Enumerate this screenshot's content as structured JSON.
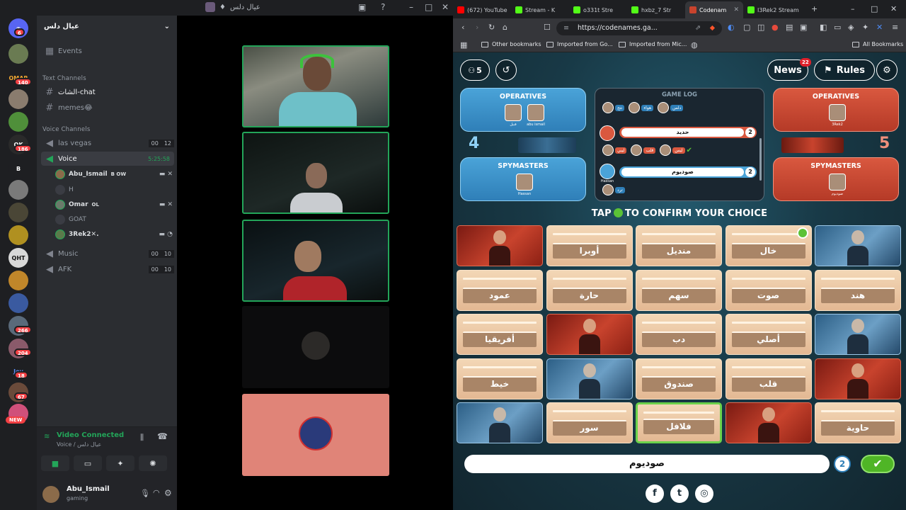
{
  "discord": {
    "window_title": "عيال دلس",
    "guild_name": "عيال دلس",
    "events_label": "Events",
    "text_channels_label": "Text Channels",
    "voice_channels_label": "Voice Channels",
    "text_channels": [
      {
        "name": "الشات-chat"
      },
      {
        "name": "memes😂"
      }
    ],
    "voice_channels": [
      {
        "name": "las vegas",
        "count_a": "00",
        "count_b": "12"
      },
      {
        "name": "Voice",
        "timer": "5:25:58"
      },
      {
        "name": "Music",
        "count_a": "00",
        "count_b": "10"
      },
      {
        "name": "AFK",
        "count_a": "00",
        "count_b": "10"
      }
    ],
    "members": [
      {
        "name": "Abu_Ismail",
        "tag": "B OW"
      },
      {
        "name": "H"
      },
      {
        "name": "Omar",
        "tag": "OL"
      },
      {
        "name": "GOAT"
      },
      {
        "name": "3Rek2✕."
      }
    ],
    "server_badges": [
      "6",
      "140",
      "186",
      "266",
      "204",
      "18",
      "67"
    ],
    "server_labels": [
      "OMAR",
      "B",
      "QHT",
      "Joy"
    ],
    "new_label": "NEW",
    "voice_status": "Video Connected",
    "voice_sub": "Voice / عيال دلس",
    "user": {
      "name": "Abu_Ismail",
      "status": "gaming"
    }
  },
  "browser": {
    "tabs": [
      {
        "label": "(672) YouTube",
        "color": "#ff0000"
      },
      {
        "label": "Stream - K",
        "color": "#53fc18"
      },
      {
        "label": "o331t Stre",
        "color": "#53fc18"
      },
      {
        "label": "hxbz_7 Str",
        "color": "#53fc18"
      },
      {
        "label": "Codenam",
        "color": "#c8432d"
      },
      {
        "label": "I3Rek2 Stream",
        "color": "#53fc18"
      }
    ],
    "url": "https://codenames.ga...",
    "bookmarks": [
      "Other bookmarks",
      "Imported from Go...",
      "Imported from Mic...",
      "All Bookmarks"
    ]
  },
  "game": {
    "players_count": "5",
    "news_label": "News",
    "news_badge": "22",
    "rules_label": "Rules",
    "blue": {
      "operatives_label": "OPERATIVES",
      "spymasters_label": "SPYMASTERS",
      "score": "4",
      "operatives": [
        "قنبل",
        "abu ismail"
      ],
      "spymaster": "Hassan"
    },
    "red": {
      "operatives_label": "OPERATIVES",
      "spymasters_label": "SPYMASTERS",
      "score": "5",
      "operatives": [
        "3Rek2"
      ],
      "spymaster": "صوديوم"
    },
    "log": {
      "title": "GAME LOG",
      "row1_tags": [
        "نتح",
        "هواء",
        "دلس"
      ],
      "clue1": {
        "word": "حديد",
        "number": "2"
      },
      "row2_tags": [
        "ليبي",
        "قلب",
        "ليس"
      ],
      "clue2": {
        "word": "صوديوم",
        "number": "2"
      },
      "row3_tags": [
        "ترد"
      ],
      "clue2_author": "Hassan"
    },
    "tap_before": "TAP",
    "tap_after": "TO CONFIRM YOUR CHOICE",
    "cards": [
      {
        "type": "red",
        "word": ""
      },
      {
        "type": "word",
        "word": "أوبرا"
      },
      {
        "type": "word",
        "word": "منديل"
      },
      {
        "type": "word",
        "word": "خال"
      },
      {
        "type": "blue",
        "word": ""
      },
      {
        "type": "word",
        "word": "عمود"
      },
      {
        "type": "word",
        "word": "حارة"
      },
      {
        "type": "word",
        "word": "سهم"
      },
      {
        "type": "word",
        "word": "صوت"
      },
      {
        "type": "word",
        "word": "هند"
      },
      {
        "type": "word",
        "word": "أفريقيا"
      },
      {
        "type": "red",
        "word": ""
      },
      {
        "type": "word",
        "word": "دب"
      },
      {
        "type": "word",
        "word": "أصلي"
      },
      {
        "type": "blue",
        "word": ""
      },
      {
        "type": "word",
        "word": "خيط"
      },
      {
        "type": "blue",
        "word": ""
      },
      {
        "type": "word",
        "word": "صندوق"
      },
      {
        "type": "word",
        "word": "قلب"
      },
      {
        "type": "red",
        "word": ""
      },
      {
        "type": "blue",
        "word": ""
      },
      {
        "type": "word",
        "word": "سور"
      },
      {
        "type": "word",
        "word": "فلافل"
      },
      {
        "type": "red",
        "word": ""
      },
      {
        "type": "word",
        "word": "حاوية"
      }
    ],
    "current_clue": "صوديوم",
    "current_number": "2",
    "confirm_icon": "✔",
    "social": [
      "f",
      "t",
      "◎"
    ]
  }
}
